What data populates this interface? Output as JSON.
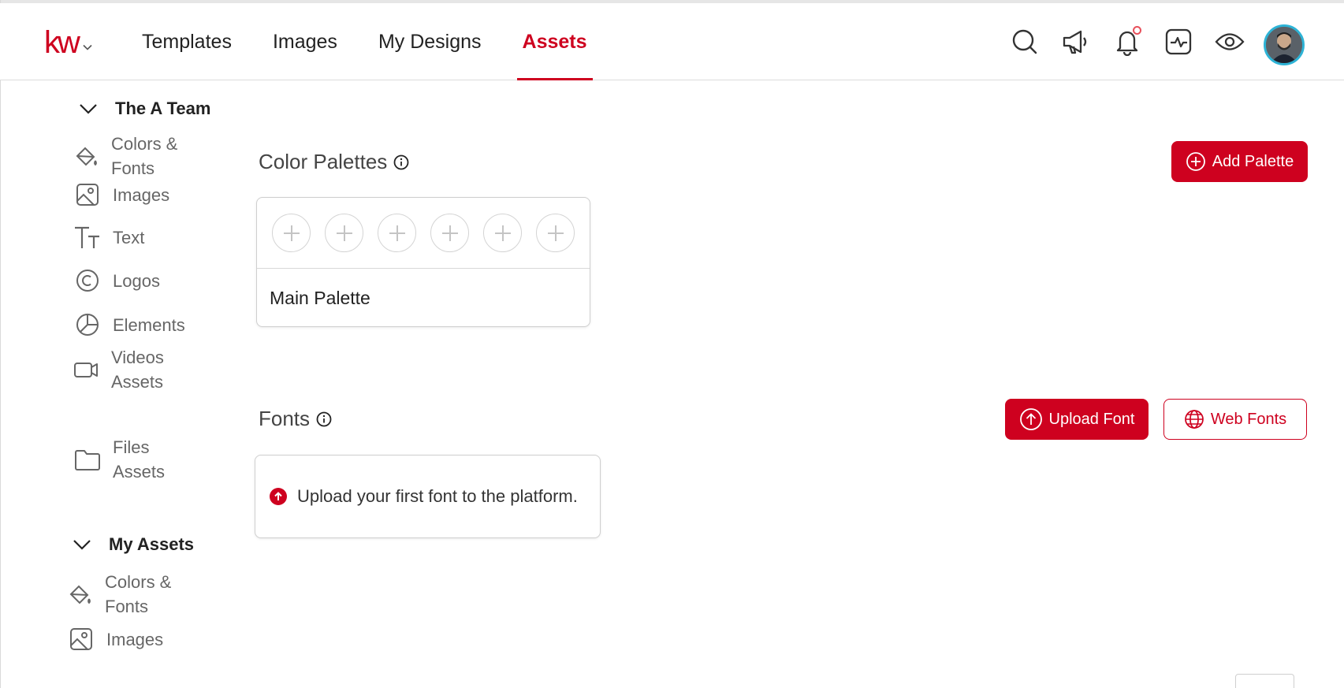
{
  "header": {
    "logo_text": "kw",
    "nav": [
      {
        "label": "Templates",
        "active": false
      },
      {
        "label": "Images",
        "active": false
      },
      {
        "label": "My Designs",
        "active": false
      },
      {
        "label": "Assets",
        "active": true
      }
    ],
    "icons": [
      "search-icon",
      "megaphone-icon",
      "bell-icon",
      "activity-icon",
      "eye-icon",
      "avatar"
    ],
    "notification_dot": true
  },
  "sidebar": {
    "team_group": {
      "label": "The A Team",
      "items": [
        {
          "label": "Colors & Fonts",
          "icon": "paint-bucket-icon"
        },
        {
          "label": "Images",
          "icon": "image-icon"
        },
        {
          "label": "Text",
          "icon": "text-icon"
        },
        {
          "label": "Logos",
          "icon": "copyright-icon"
        },
        {
          "label": "Elements",
          "icon": "pie-icon"
        },
        {
          "label": "Videos Assets",
          "icon": "video-icon"
        },
        {
          "label": "Files Assets",
          "icon": "folder-icon"
        }
      ]
    },
    "my_group": {
      "label": "My Assets",
      "items": [
        {
          "label": "Colors & Fonts",
          "icon": "paint-bucket-icon"
        },
        {
          "label": "Images",
          "icon": "image-icon"
        }
      ]
    }
  },
  "main": {
    "palettes": {
      "title": "Color Palettes",
      "add_button": "Add Palette",
      "card": {
        "name": "Main Palette",
        "swatch_count": 6
      }
    },
    "fonts": {
      "title": "Fonts",
      "upload_button": "Upload Font",
      "web_button": "Web Fonts",
      "empty_message": "Upload your first font to the platform."
    }
  },
  "colors": {
    "brand": "#ce011f",
    "avatar_ring": "#2db3d6",
    "notification": "#e8505b"
  }
}
